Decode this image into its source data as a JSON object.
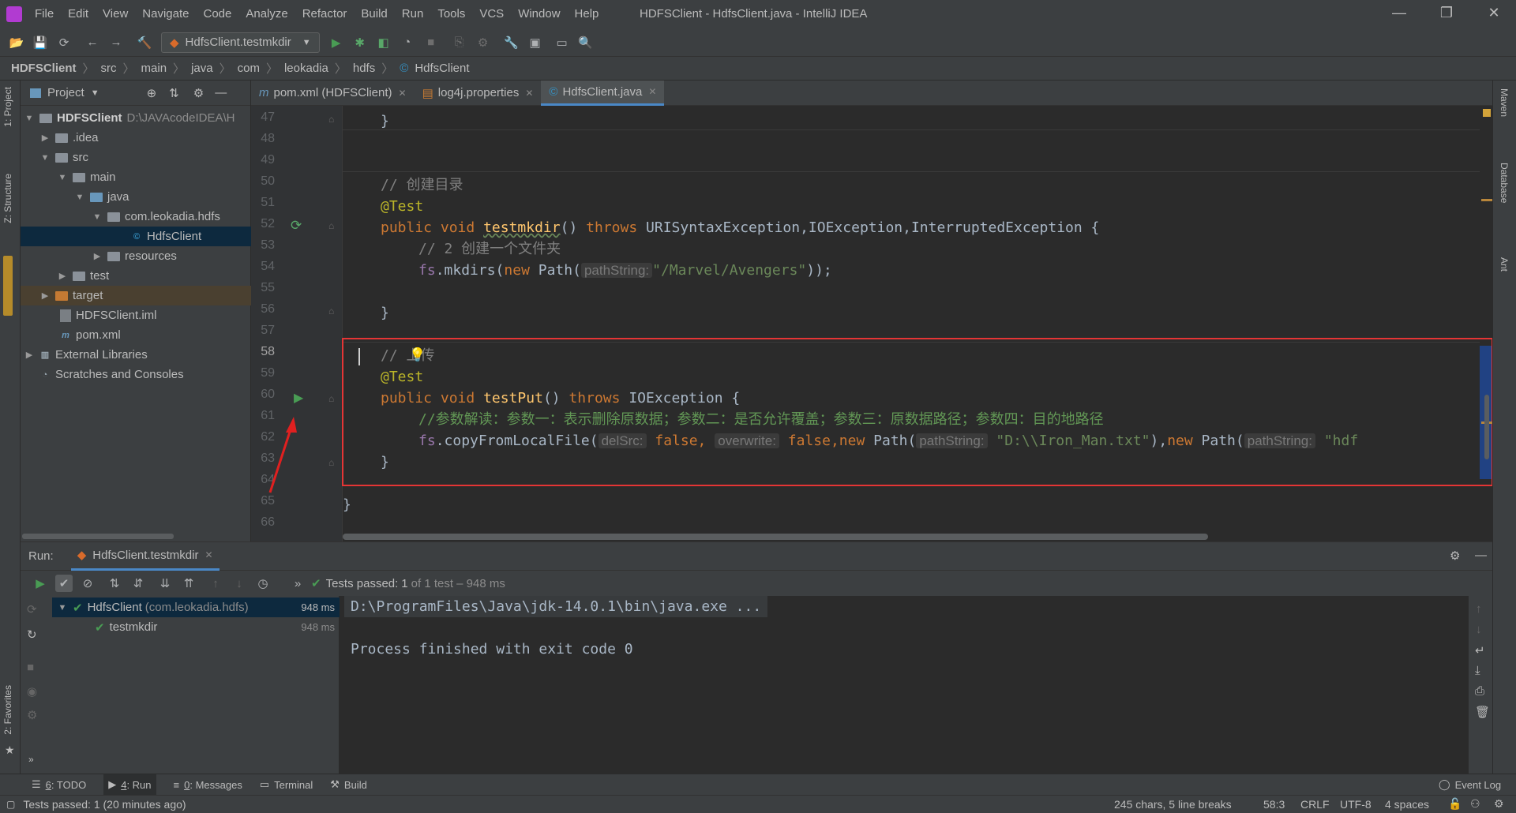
{
  "window": {
    "title": "HDFSClient - HdfsClient.java - IntelliJ IDEA",
    "menu": [
      "File",
      "Edit",
      "View",
      "Navigate",
      "Code",
      "Analyze",
      "Refactor",
      "Build",
      "Run",
      "Tools",
      "VCS",
      "Window",
      "Help"
    ]
  },
  "toolbar": {
    "run_config": "HdfsClient.testmkdir"
  },
  "breadcrumb": [
    "HDFSClient",
    "src",
    "main",
    "java",
    "com",
    "leokadia",
    "hdfs",
    "HdfsClient"
  ],
  "project_panel": {
    "title": "Project",
    "tree": [
      {
        "label": "HDFSClient",
        "extra": "D:\\JAVAcodeIDEA\\H"
      },
      {
        "label": ".idea"
      },
      {
        "label": "src"
      },
      {
        "label": "main"
      },
      {
        "label": "java"
      },
      {
        "label": "com.leokadia.hdfs"
      },
      {
        "label": "HdfsClient"
      },
      {
        "label": "resources"
      },
      {
        "label": "test"
      },
      {
        "label": "target"
      },
      {
        "label": "HDFSClient.iml"
      },
      {
        "label": "pom.xml"
      },
      {
        "label": "External Libraries"
      },
      {
        "label": "Scratches and Consoles"
      }
    ]
  },
  "left_stripe": [
    "1: Project",
    "Z: Structure",
    "2: Favorites"
  ],
  "right_stripe": [
    "Maven",
    "Database",
    "Ant"
  ],
  "tabs": [
    {
      "label": "pom.xml (HDFSClient)"
    },
    {
      "label": "log4j.properties"
    },
    {
      "label": "HdfsClient.java"
    }
  ],
  "line_numbers": [
    "47",
    "48",
    "49",
    "50",
    "51",
    "52",
    "53",
    "54",
    "55",
    "56",
    "57",
    "58",
    "59",
    "60",
    "61",
    "62",
    "63",
    "64",
    "65",
    "66"
  ],
  "code": {
    "l47": "}",
    "l50_comment": "// 创建目录",
    "l51_ann": "@Test",
    "l52": {
      "public": "public",
      "void": "void",
      "name": "testmkdir",
      "paren": "() ",
      "throws": "throws",
      "types": "URISyntaxException,IOException,InterruptedException {"
    },
    "l53_comment": "// 2 创建一个文件夹",
    "l54": {
      "fs": "fs",
      "call": ".mkdirs(",
      "new": "new",
      "path": " Path(",
      "hint": "pathString:",
      "str": "\"/Marvel/Avengers\"",
      "end": "));"
    },
    "l56": "}",
    "l58_comment": "// 上传",
    "l59_ann": "@Test",
    "l60": {
      "public": "public",
      "void": "void",
      "name": "testPut",
      "paren": "() ",
      "throws": "throws",
      "types": "IOException {"
    },
    "l61_comment": "//参数解读：参数一：表示删除原数据；参数二：是否允许覆盖；参数三：原数据路径；参数四：目的地路径",
    "l62": {
      "fs": "fs",
      "call": ".copyFromLocalFile(",
      "hint1": "delSrc:",
      "v1": "false",
      "comma": ",",
      "hint2": "overwrite:",
      "v2": "false",
      "new1": ",new",
      "path1": " Path(",
      "hint3": "pathString:",
      "str1": "\"D:\\\\Iron_Man.txt\"",
      "close1": "),",
      "new2": "new",
      "path2": " Path(",
      "hint4": "pathString:",
      "str2": "\"hdf"
    },
    "l63": "}",
    "l65": "}"
  },
  "run_panel": {
    "label": "Run:",
    "tab": "HdfsClient.testmkdir",
    "status": "Tests passed:",
    "status_count": "1",
    "status_detail": "of 1 test – 948 ms",
    "tree": [
      {
        "label": "HdfsClient",
        "package": "(com.leokadia.hdfs)",
        "time": "948 ms"
      },
      {
        "label": "testmkdir",
        "time": "948 ms"
      }
    ],
    "console": [
      "D:\\ProgramFiles\\Java\\jdk-14.0.1\\bin\\java.exe ...",
      "",
      "Process finished with exit code 0"
    ]
  },
  "bottom_tools": [
    {
      "key": "6",
      "label": ": TODO"
    },
    {
      "key": "4",
      "label": ": Run"
    },
    {
      "key": "0",
      "label": ": Messages"
    },
    {
      "key": "",
      "label": "Terminal"
    },
    {
      "key": "",
      "label": "Build"
    }
  ],
  "event_log": "Event Log",
  "status_bar": {
    "message": "Tests passed: 1 (20 minutes ago)",
    "chars": "245 chars, 5 line breaks",
    "position": "58:3",
    "line_sep": "CRLF",
    "encoding": "UTF-8",
    "indent": "4 spaces"
  },
  "colors": {
    "selection": "#214283",
    "annotation_box": "#e53535",
    "keyword": "#cc7832",
    "string": "#6a8759"
  }
}
